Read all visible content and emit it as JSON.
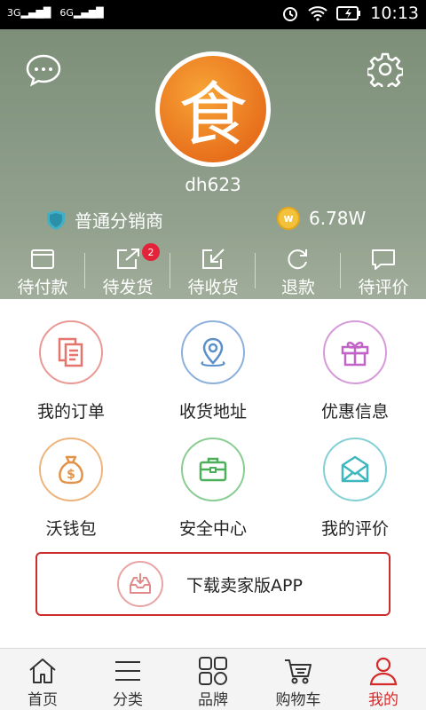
{
  "status_bar": {
    "sim1": "3G",
    "sim2": "G",
    "time": "10:13"
  },
  "header": {
    "avatar_char": "食",
    "username": "dh623",
    "role": "普通分销商",
    "coins": "6.78W",
    "coin_symbol": "w"
  },
  "order_bar": [
    {
      "label": "待付款",
      "icon": "wallet-icon"
    },
    {
      "label": "待发货",
      "icon": "ship-icon",
      "badge": "2"
    },
    {
      "label": "待收货",
      "icon": "receive-icon"
    },
    {
      "label": "退款",
      "icon": "refund-icon"
    },
    {
      "label": "待评价",
      "icon": "comment-icon"
    }
  ],
  "grid": [
    {
      "label": "我的订单",
      "icon": "document-icon",
      "color": "#e5756f"
    },
    {
      "label": "收货地址",
      "icon": "location-icon",
      "color": "#5b8fc9"
    },
    {
      "label": "优惠信息",
      "icon": "gift-icon",
      "color": "#c263c8"
    },
    {
      "label": "沃钱包",
      "icon": "money-bag-icon",
      "color": "#e39347"
    },
    {
      "label": "安全中心",
      "icon": "briefcase-icon",
      "color": "#4cb05a"
    },
    {
      "label": "我的评价",
      "icon": "envelope-icon",
      "color": "#3fb7bf"
    }
  ],
  "download": {
    "label": "下载卖家版APP"
  },
  "tabs": [
    {
      "label": "首页",
      "icon": "home-icon",
      "active": false
    },
    {
      "label": "分类",
      "icon": "menu-icon",
      "active": false
    },
    {
      "label": "品牌",
      "icon": "brand-icon",
      "active": false
    },
    {
      "label": "购物车",
      "icon": "cart-icon",
      "active": false
    },
    {
      "label": "我的",
      "icon": "user-icon",
      "active": true
    }
  ],
  "colors": {
    "accent": "#d42a2a",
    "header_bg": "#889985",
    "avatar_orange": "#e8711d"
  }
}
